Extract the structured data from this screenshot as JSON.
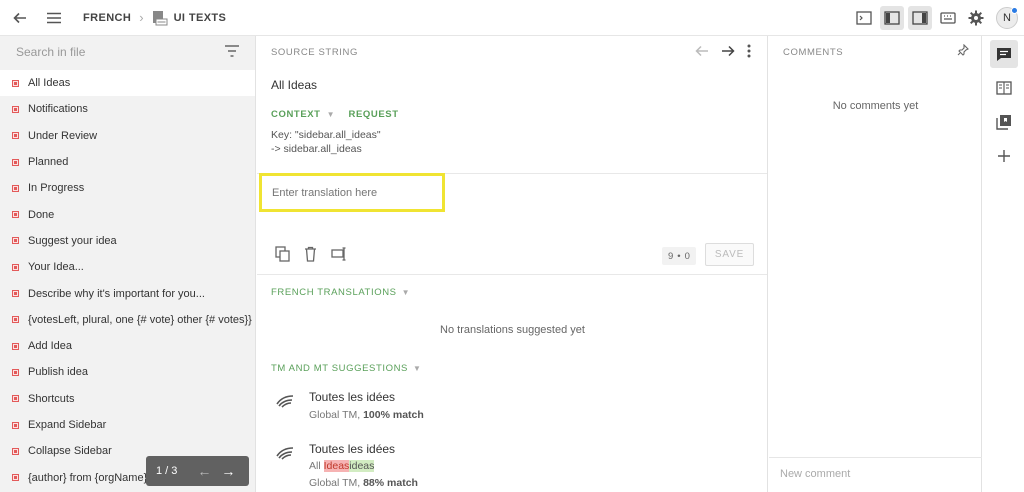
{
  "header": {
    "project": "FRENCH",
    "file": "UI TEXTS",
    "avatar_initial": "N"
  },
  "left_panel": {
    "search_placeholder": "Search in file",
    "items": [
      "All Ideas",
      "Notifications",
      "Under Review",
      "Planned",
      "In Progress",
      "Done",
      "Suggest your idea",
      "Your Idea...",
      "Describe why it's important for you...",
      "{votesLeft, plural, one {# vote} other {# votes}} le...",
      "Add Idea",
      "Publish idea",
      "Shortcuts",
      "Expand Sidebar",
      "Collapse Sidebar",
      "{author} from {orgName}"
    ],
    "pager": "1 / 3"
  },
  "source": {
    "title": "SOURCE STRING",
    "text": "All Ideas",
    "context_label": "CONTEXT",
    "request_label": "REQUEST",
    "key_line": "Key: \"sidebar.all_ideas\"",
    "path_line": "-> sidebar.all_ideas"
  },
  "editor": {
    "placeholder": "Enter translation here",
    "count_left": "9",
    "count_right": "0",
    "save_label": "SAVE"
  },
  "translations": {
    "title": "FRENCH TRANSLATIONS",
    "empty": "No translations suggested yet"
  },
  "tm": {
    "title": "TM AND MT SUGGESTIONS",
    "suggestions": [
      {
        "text": "Toutes les idées",
        "source": "Global TM,",
        "match": "100% match"
      },
      {
        "text": "Toutes les idées",
        "diff_prefix": "All ",
        "diff_del": "Ideas",
        "diff_add": "ideas",
        "source": "Global TM,",
        "match": "88% match"
      }
    ]
  },
  "comments": {
    "title": "COMMENTS",
    "empty": "No comments yet",
    "new_placeholder": "New comment"
  }
}
